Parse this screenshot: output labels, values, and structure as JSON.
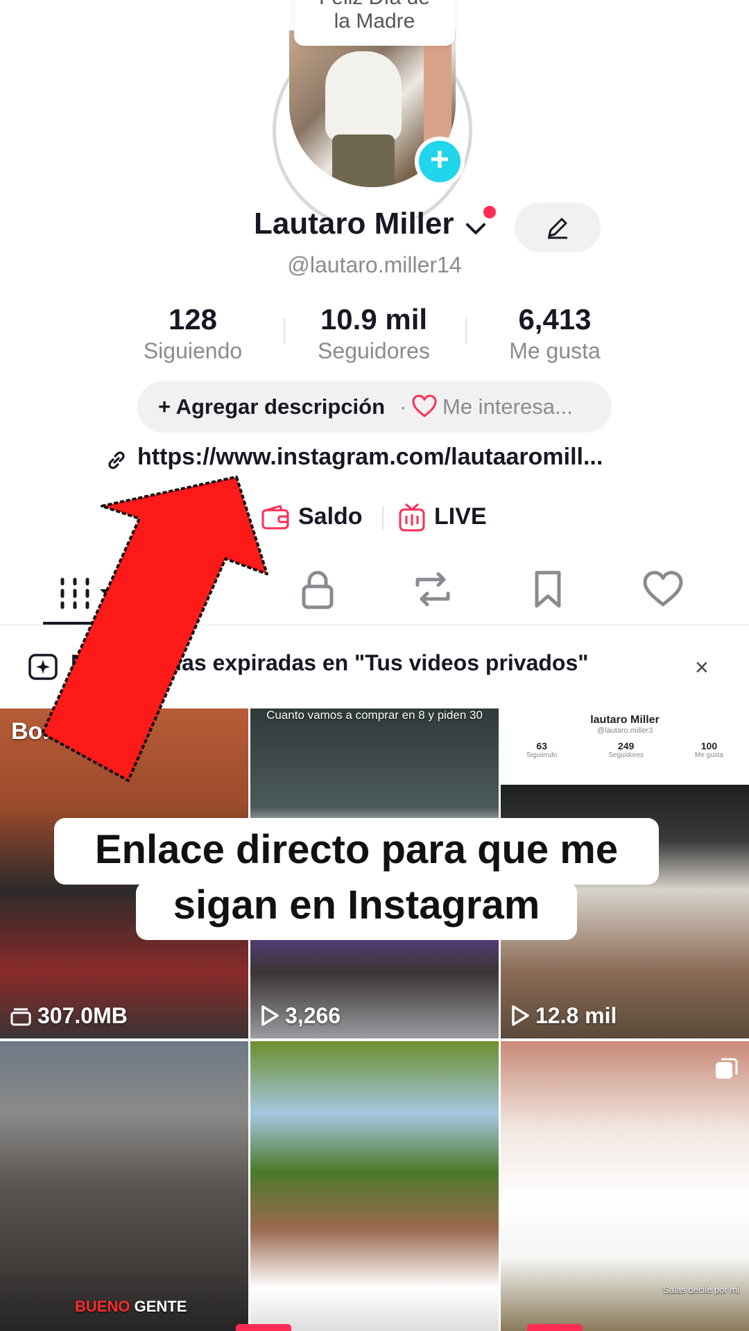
{
  "story_bubble": {
    "line1": "Feliz Día de",
    "line2": "la Madre"
  },
  "profile": {
    "name": "Lautaro Miller",
    "handle": "@lautaro.miller14",
    "stats": [
      {
        "value": "128",
        "label": "Siguiendo"
      },
      {
        "value": "10.9 mil",
        "label": "Seguidores"
      },
      {
        "value": "6,413",
        "label": "Me gusta"
      }
    ],
    "add_description": "+ Agregar descripción",
    "separator": "·",
    "interests": "Me interesa...",
    "link": "https://www.instagram.com/lautaaromill...",
    "saldo": "Saldo",
    "live": "LIVE"
  },
  "notice": {
    "text": "Mis historias expiradas en \"Tus videos privados\"",
    "close": "×"
  },
  "grid": [
    {
      "tag": "Borradores",
      "count": "307.0MB",
      "count_icon": "drafts-icon"
    },
    {
      "caption": "Cuanto vamos a comprar en 8 y piden 30",
      "count": "3,266",
      "count_icon": "play-icon"
    },
    {
      "count": "12.8 mil",
      "count_icon": "play-icon",
      "mini_profile": {
        "name": "lautaro Miller",
        "handle": "@lautaro.miller3",
        "stats": [
          {
            "value": "63",
            "label": "Siguiendo"
          },
          {
            "value": "249",
            "label": "Seguidores"
          },
          {
            "value": "100",
            "label": "Me gusta"
          }
        ]
      }
    },
    {
      "caption_red": "BUENO",
      "caption_white": "GENTE"
    },
    {},
    {
      "caption": "Salas decile por mi"
    }
  ],
  "overlay": {
    "line1": "Enlace directo para que me",
    "line2": "sigan en Instagram"
  },
  "colors": {
    "accent": "#fe2c55",
    "plus": "#20d5ec",
    "arrow": "#ff1a1a"
  }
}
